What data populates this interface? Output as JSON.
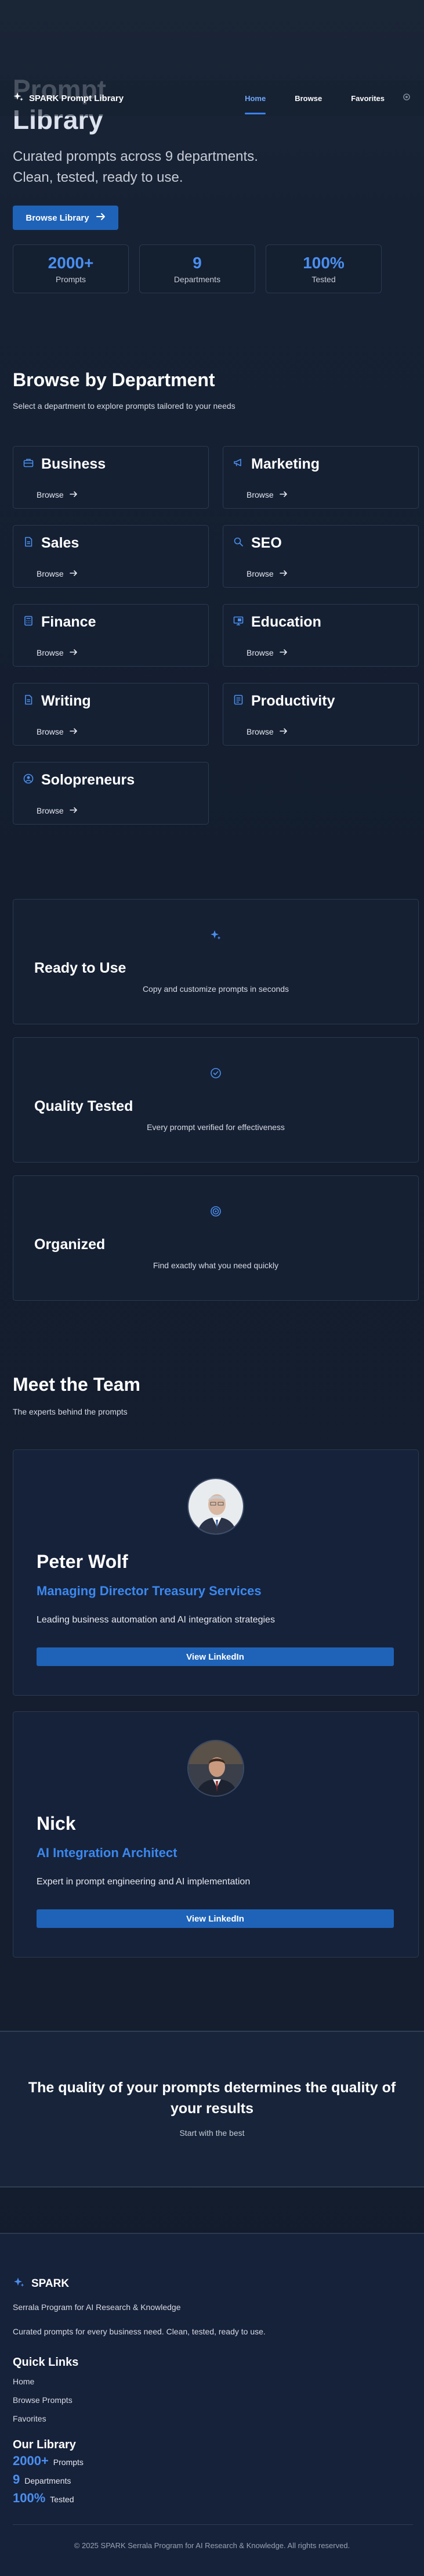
{
  "nav": {
    "brand": "SPARK Prompt Library",
    "links": [
      "Home",
      "Browse",
      "Favorites"
    ],
    "active": "Home",
    "extra_icon": "gear-icon"
  },
  "hero": {
    "title_line1": "Prompt",
    "title_line2": "Library",
    "subtitle_line1": "Curated prompts across 9 departments.",
    "subtitle_line2": "Clean, tested, ready to use.",
    "button": "Browse Library",
    "stats": [
      {
        "value": "2000+",
        "label": "Prompts"
      },
      {
        "value": "9",
        "label": "Departments"
      },
      {
        "value": "100%",
        "label": "Tested"
      }
    ]
  },
  "departments": {
    "title": "Browse by Department",
    "subtitle": "Select a department to explore prompts tailored to your needs",
    "browse_label": "Browse",
    "items": [
      {
        "name": "Business",
        "icon": "briefcase-icon"
      },
      {
        "name": "Marketing",
        "icon": "megaphone-icon"
      },
      {
        "name": "Sales",
        "icon": "document-icon"
      },
      {
        "name": "SEO",
        "icon": "search-icon"
      },
      {
        "name": "Finance",
        "icon": "calculator-icon"
      },
      {
        "name": "Education",
        "icon": "monitor-icon"
      },
      {
        "name": "Writing",
        "icon": "document-icon"
      },
      {
        "name": "Productivity",
        "icon": "checklist-icon"
      },
      {
        "name": "Solopreneurs",
        "icon": "user-icon"
      }
    ]
  },
  "features": [
    {
      "title": "Ready to Use",
      "desc": "Copy and customize prompts in seconds",
      "icon": "sparkle-icon"
    },
    {
      "title": "Quality Tested",
      "desc": "Every prompt verified for effectiveness",
      "icon": "check-circle-icon"
    },
    {
      "title": "Organized",
      "desc": "Find exactly what you need quickly",
      "icon": "target-icon"
    }
  ],
  "team": {
    "title": "Meet the Team",
    "subtitle": "The experts behind the prompts",
    "button": "View LinkedIn",
    "members": [
      {
        "name": "Peter Wolf",
        "role": "Managing Director Treasury Services",
        "bio": "Leading business automation and AI integration strategies"
      },
      {
        "name": "Nick",
        "role": "AI Integration Architect",
        "bio": "Expert in prompt engineering and AI implementation"
      }
    ]
  },
  "cta": {
    "title": "The quality of your prompts determines the quality of your results",
    "subtitle": "Start with the best"
  },
  "footer": {
    "brand": "SPARK",
    "program": "Serrala Program for AI Research & Knowledge",
    "tagline": "Curated prompts for every business need. Clean, tested, ready to use.",
    "quick_links_title": "Quick Links",
    "quick_links": [
      "Home",
      "Browse Prompts",
      "Favorites"
    ],
    "library_title": "Our Library",
    "library_stats": [
      {
        "value": "2000+",
        "label": "Prompts"
      },
      {
        "value": "9",
        "label": "Departments"
      },
      {
        "value": "100%",
        "label": "Tested"
      }
    ],
    "copyright": "© 2025 SPARK Serrala Program for AI Research & Knowledge. All rights reserved."
  },
  "colors": {
    "accent": "#3b82f6",
    "button": "#1f63b8",
    "role": "#3b88ef",
    "card_bg": "#152033",
    "card_border": "#2b3a52"
  }
}
